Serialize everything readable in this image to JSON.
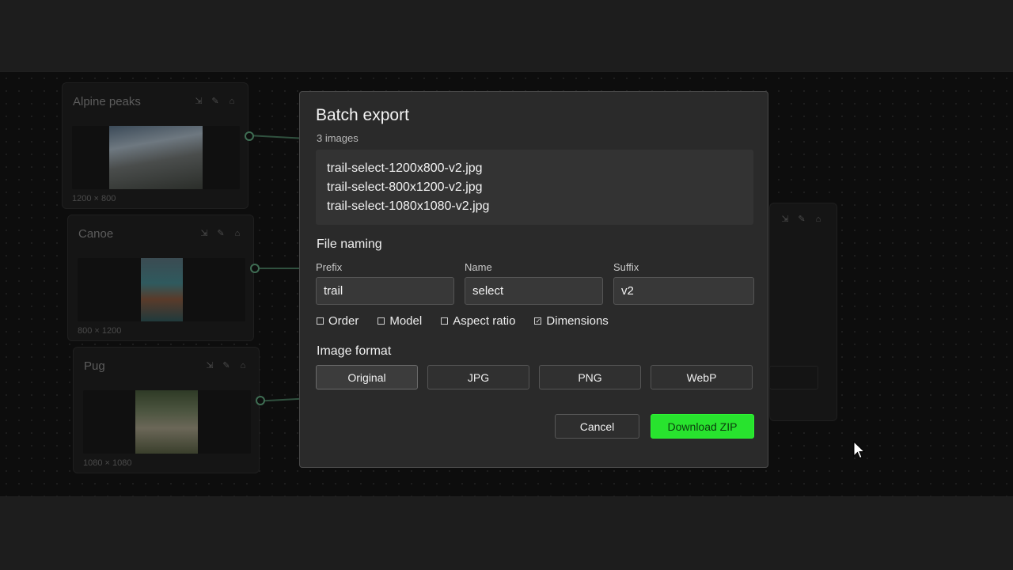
{
  "nodes": [
    {
      "title": "Alpine peaks",
      "dims": "1200 × 800"
    },
    {
      "title": "Canoe",
      "dims": "800 × 1200"
    },
    {
      "title": "Pug",
      "dims": "1080 × 1080"
    }
  ],
  "node_tools": {
    "collapse_icon": "⇲",
    "edit_icon": "✎",
    "lock_icon": "🔒"
  },
  "modal": {
    "title": "Batch export",
    "subtitle": "3 images",
    "files": [
      "trail-select-1200x800-v2.jpg",
      "trail-select-800x1200-v2.jpg",
      "trail-select-1080x1080-v2.jpg"
    ],
    "file_naming_label": "File naming",
    "prefix_label": "Prefix",
    "prefix_value": "trail",
    "name_label": "Name",
    "name_value": "select",
    "suffix_label": "Suffix",
    "suffix_value": "v2",
    "checkboxes": [
      {
        "label": "Order",
        "checked": false
      },
      {
        "label": "Model",
        "checked": false
      },
      {
        "label": "Aspect ratio",
        "checked": false
      },
      {
        "label": "Dimensions",
        "checked": true
      }
    ],
    "image_format_label": "Image format",
    "formats": [
      "Original",
      "JPG",
      "PNG",
      "WebP"
    ],
    "selected_format": "Original",
    "cancel_label": "Cancel",
    "download_label": "Download ZIP"
  },
  "colors": {
    "accent": "#28e32e",
    "wire": "#30513f"
  }
}
